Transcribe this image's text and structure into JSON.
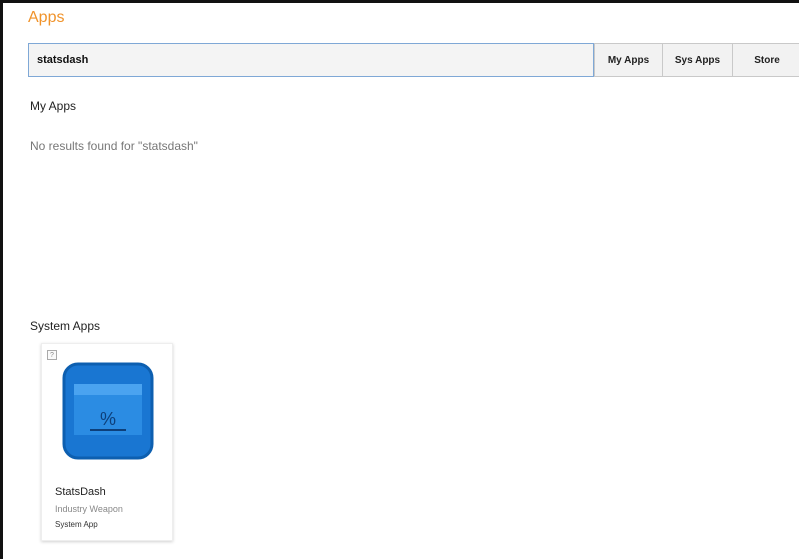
{
  "header": {
    "title": "Apps"
  },
  "search": {
    "value": "statsdash",
    "placeholder": ""
  },
  "tabs": [
    {
      "label": "My Apps"
    },
    {
      "label": "Sys Apps"
    },
    {
      "label": "Store"
    }
  ],
  "my_apps": {
    "heading": "My Apps",
    "empty_message": "No results found for \"statsdash\""
  },
  "system_apps": {
    "heading": "System Apps",
    "items": [
      {
        "name": "StatsDash",
        "company": "Industry Weapon",
        "type": "System App",
        "icon": "percent-panel-icon",
        "help_glyph": "?"
      }
    ]
  },
  "colors": {
    "title": "#f0932b",
    "icon_primary": "#1976d2",
    "icon_border": "#0d5fb0",
    "icon_panel": "#2b8ce3"
  }
}
